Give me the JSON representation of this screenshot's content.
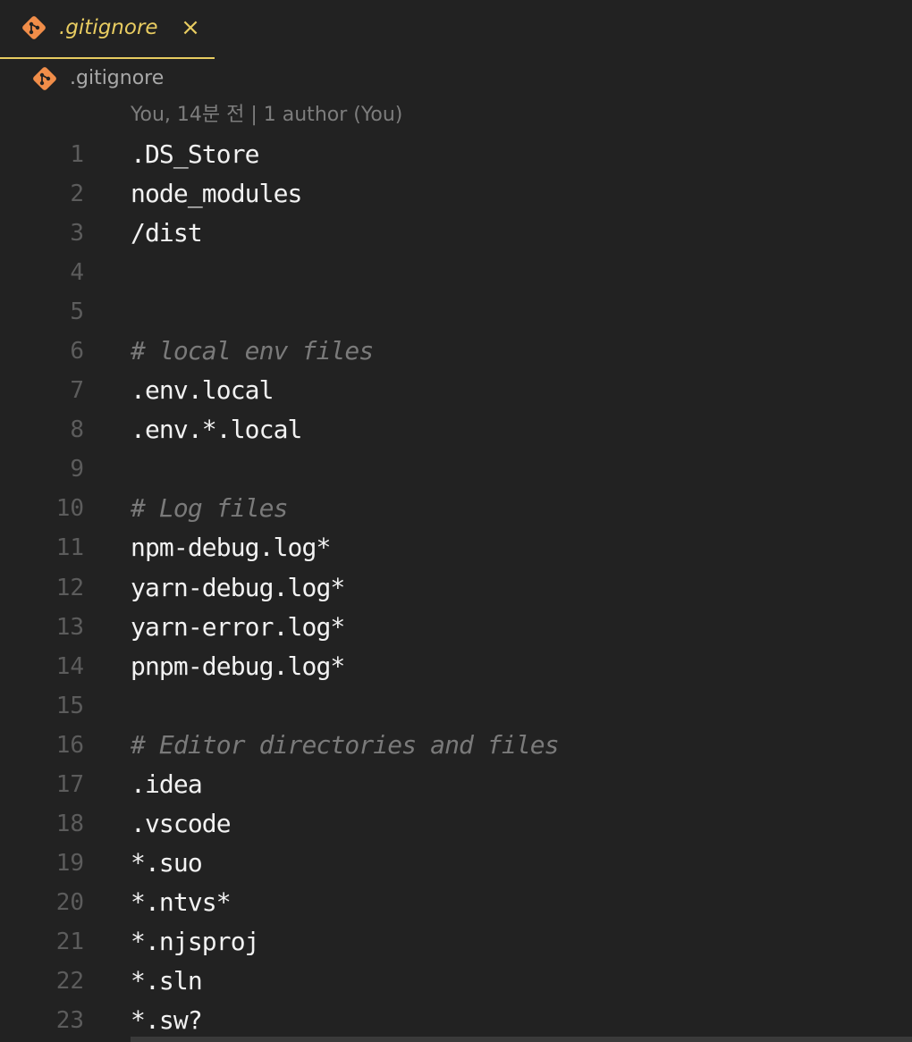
{
  "tab": {
    "label": ".gitignore",
    "icon": "git-icon",
    "close_label": "×"
  },
  "breadcrumb": {
    "label": ".gitignore",
    "icon": "git-icon"
  },
  "blame": {
    "text": "You, 14분 전 | 1 author (You)"
  },
  "colors": {
    "accent": "#e8cc61",
    "git_icon": "#f08d49",
    "background": "#222222",
    "comment": "#7a7a7a",
    "text": "#f2f2f2"
  },
  "lines": [
    {
      "num": "1",
      "text": ".DS_Store",
      "type": "code"
    },
    {
      "num": "2",
      "text": "node_modules",
      "type": "code"
    },
    {
      "num": "3",
      "text": "/dist",
      "type": "code"
    },
    {
      "num": "4",
      "text": "",
      "type": "code"
    },
    {
      "num": "5",
      "text": "",
      "type": "code"
    },
    {
      "num": "6",
      "text": "# local env files",
      "type": "comment"
    },
    {
      "num": "7",
      "text": ".env.local",
      "type": "code"
    },
    {
      "num": "8",
      "text": ".env.*.local",
      "type": "code"
    },
    {
      "num": "9",
      "text": "",
      "type": "code"
    },
    {
      "num": "10",
      "text": "# Log files",
      "type": "comment"
    },
    {
      "num": "11",
      "text": "npm-debug.log*",
      "type": "code"
    },
    {
      "num": "12",
      "text": "yarn-debug.log*",
      "type": "code"
    },
    {
      "num": "13",
      "text": "yarn-error.log*",
      "type": "code"
    },
    {
      "num": "14",
      "text": "pnpm-debug.log*",
      "type": "code"
    },
    {
      "num": "15",
      "text": "",
      "type": "code"
    },
    {
      "num": "16",
      "text": "# Editor directories and files",
      "type": "comment"
    },
    {
      "num": "17",
      "text": ".idea",
      "type": "code"
    },
    {
      "num": "18",
      "text": ".vscode",
      "type": "code"
    },
    {
      "num": "19",
      "text": "*.suo",
      "type": "code"
    },
    {
      "num": "20",
      "text": "*.ntvs*",
      "type": "code"
    },
    {
      "num": "21",
      "text": "*.njsproj",
      "type": "code"
    },
    {
      "num": "22",
      "text": "*.sln",
      "type": "code"
    },
    {
      "num": "23",
      "text": "*.sw?",
      "type": "code"
    }
  ]
}
